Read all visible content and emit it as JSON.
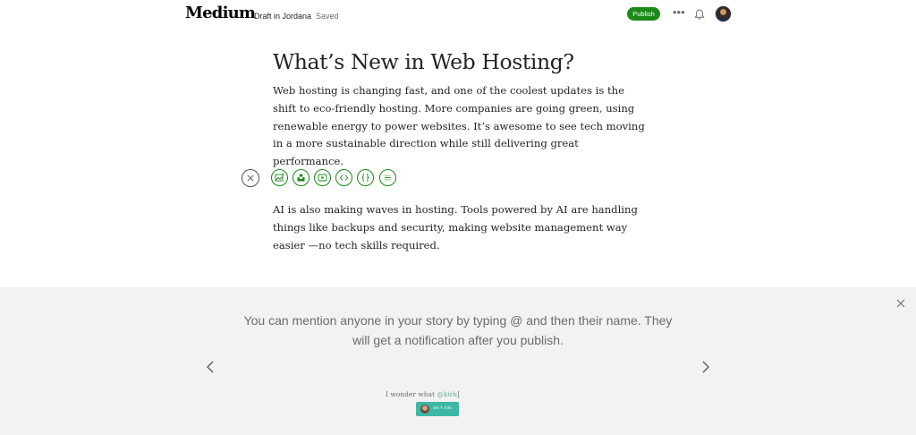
{
  "header": {
    "logo": "Medium",
    "draft_label": "Draft in Jordana",
    "status": "Saved",
    "publish_label": "Publish",
    "more_label": "•••"
  },
  "article": {
    "title": "What’s New in Web Hosting?",
    "paragraph1": "Web hosting is changing fast, and one of the coolest updates is the shift to eco-friendly hosting. More companies are going green, using renewable energy to power websites. It’s awesome to see tech moving in a more sustainable direction while still delivering great performance.",
    "paragraph2": "AI is also making waves in hosting. Tools powered by AI are handling things like backups and security, making website management way easier —no tech skills required."
  },
  "toolbar": {
    "icons": [
      "close-icon",
      "add-image-icon",
      "unsplash-icon",
      "video-icon",
      "embed-icon",
      "code-block-icon",
      "separator-icon"
    ]
  },
  "tip": {
    "text": "You can mention anyone in your story by typing @ and then their name. They will get a notification after you publish.",
    "demo_prefix": "I wonder what ",
    "demo_mention": "@kirk",
    "mention_name": "Jim T. Kirk"
  },
  "colors": {
    "accent": "#1a8917",
    "panel_bg": "#f2f2f2",
    "mention": "#3cb8a4"
  }
}
